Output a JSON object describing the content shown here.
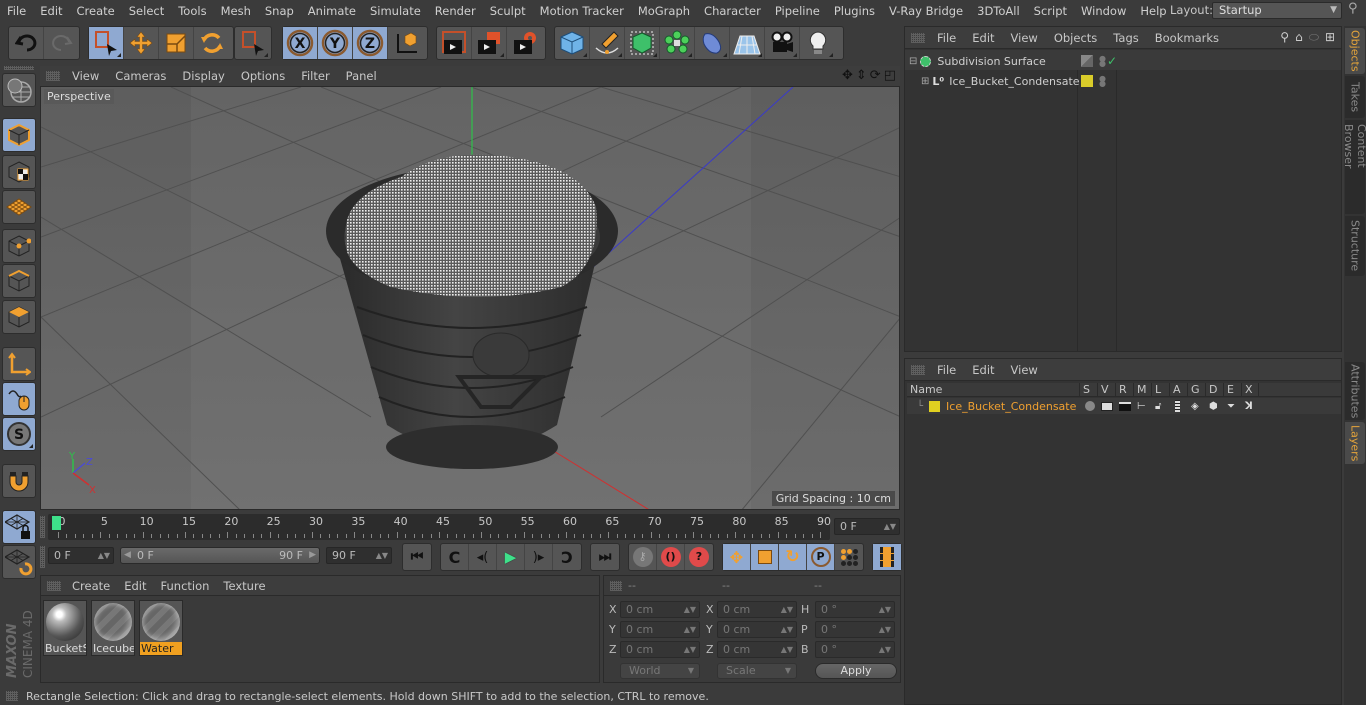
{
  "menubar": {
    "items": [
      "File",
      "Edit",
      "Create",
      "Select",
      "Tools",
      "Mesh",
      "Snap",
      "Animate",
      "Simulate",
      "Render",
      "Sculpt",
      "Motion Tracker",
      "MoGraph",
      "Character",
      "Pipeline",
      "Plugins",
      "V-Ray Bridge",
      "3DToAll",
      "Script",
      "Window",
      "Help"
    ],
    "layout_label": "Layout:",
    "layout_value": "Startup"
  },
  "toolbar": {
    "groups": [
      [
        "undo-icon",
        "redo-icon"
      ],
      [
        "rectangle-selection-icon",
        "move-icon",
        "scale-icon",
        "rotate-icon"
      ],
      [
        "live-selection-icon"
      ],
      [
        "x-axis-lock-icon",
        "y-axis-lock-icon",
        "z-axis-lock-icon",
        "coordinate-system-icon"
      ],
      [
        "render-view-icon",
        "render-picture-viewer-icon",
        "render-settings-icon"
      ],
      [
        "cube-primitive-icon",
        "pen-spline-icon",
        "subdivision-surface-icon",
        "mograph-cloner-icon",
        "deformer-icon",
        "floor-icon",
        "camera-icon",
        "light-icon"
      ]
    ],
    "active": [
      "rectangle-selection-icon"
    ]
  },
  "left_toolbar": {
    "tools": [
      "model-mode",
      "texture-mode",
      "workplane-mode",
      "points-mode",
      "edges-mode",
      "polygons-mode",
      "axis-mode",
      "tweak-mode",
      "snap-mode",
      "magnet-tool",
      "locked-workplane",
      "planar-workplane"
    ],
    "active": [
      "model-mode",
      "tweak-mode",
      "snap-mode",
      "locked-workplane"
    ]
  },
  "viewport": {
    "menu": [
      "View",
      "Cameras",
      "Display",
      "Options",
      "Filter",
      "Panel"
    ],
    "camera_label": "Perspective",
    "grid_spacing": "Grid Spacing : 10 cm",
    "axis_labels": {
      "x": "X",
      "y": "Y",
      "z": "Z"
    },
    "nav_icons": [
      "pan-icon",
      "dolly-icon",
      "orbit-icon",
      "maximize-view-icon"
    ]
  },
  "object_manager": {
    "menu": [
      "File",
      "Edit",
      "View",
      "Objects",
      "Tags",
      "Bookmarks"
    ],
    "objects": [
      {
        "name": "Subdivision Surface",
        "type": "subdivision-surface",
        "expanded": true,
        "enabled": true
      },
      {
        "name": "Ice_Bucket_Condensate",
        "type": "null-object",
        "expanded": false,
        "layer_color": "#d9cc2a"
      }
    ]
  },
  "side_tabs": {
    "top": [
      {
        "label": "Objects",
        "active": true
      },
      {
        "label": "Takes",
        "active": false
      },
      {
        "label": "Content Browser",
        "active": false
      },
      {
        "label": "Structure",
        "active": false
      }
    ],
    "bottom": [
      {
        "label": "Attributes",
        "active": false
      },
      {
        "label": "Layers",
        "active": true
      }
    ]
  },
  "layer_manager": {
    "menu": [
      "File",
      "Edit",
      "View"
    ],
    "columns": [
      "Name",
      "S",
      "V",
      "R",
      "M",
      "L",
      "A",
      "G",
      "D",
      "E",
      "X"
    ],
    "layers": [
      {
        "name": "Ice_Bucket_Condensate",
        "color": "#e0d020"
      }
    ]
  },
  "timeline": {
    "ticks": [
      "0",
      "5",
      "10",
      "15",
      "20",
      "25",
      "30",
      "35",
      "40",
      "45",
      "50",
      "55",
      "60",
      "65",
      "70",
      "75",
      "80",
      "85",
      "90"
    ],
    "current_frame": "0 F",
    "start_field": "0 F",
    "range_start": "0 F",
    "range_end": "90 F",
    "end_field": "90 F"
  },
  "materials": {
    "menu": [
      "Create",
      "Edit",
      "Function",
      "Texture"
    ],
    "items": [
      {
        "name": "BucketS",
        "selected": false
      },
      {
        "name": "Icecubes",
        "selected": false
      },
      {
        "name": "Water",
        "selected": true
      }
    ]
  },
  "coordinates": {
    "headers": [
      "--",
      "--",
      "--"
    ],
    "position": {
      "X": "0 cm",
      "Y": "0 cm",
      "Z": "0 cm"
    },
    "size": {
      "X": "0 cm",
      "Y": "0 cm",
      "Z": "0 cm"
    },
    "rotation": {
      "H": "0 °",
      "P": "0 °",
      "B": "0 °"
    },
    "mode_select": "World",
    "type_select": "Scale",
    "apply_label": "Apply"
  },
  "brand": {
    "company": "MAXON",
    "product": "CINEMA 4D"
  },
  "status": {
    "text": "Rectangle Selection: Click and drag to rectangle-select elements. Hold down SHIFT to add to the selection, CTRL to remove."
  }
}
